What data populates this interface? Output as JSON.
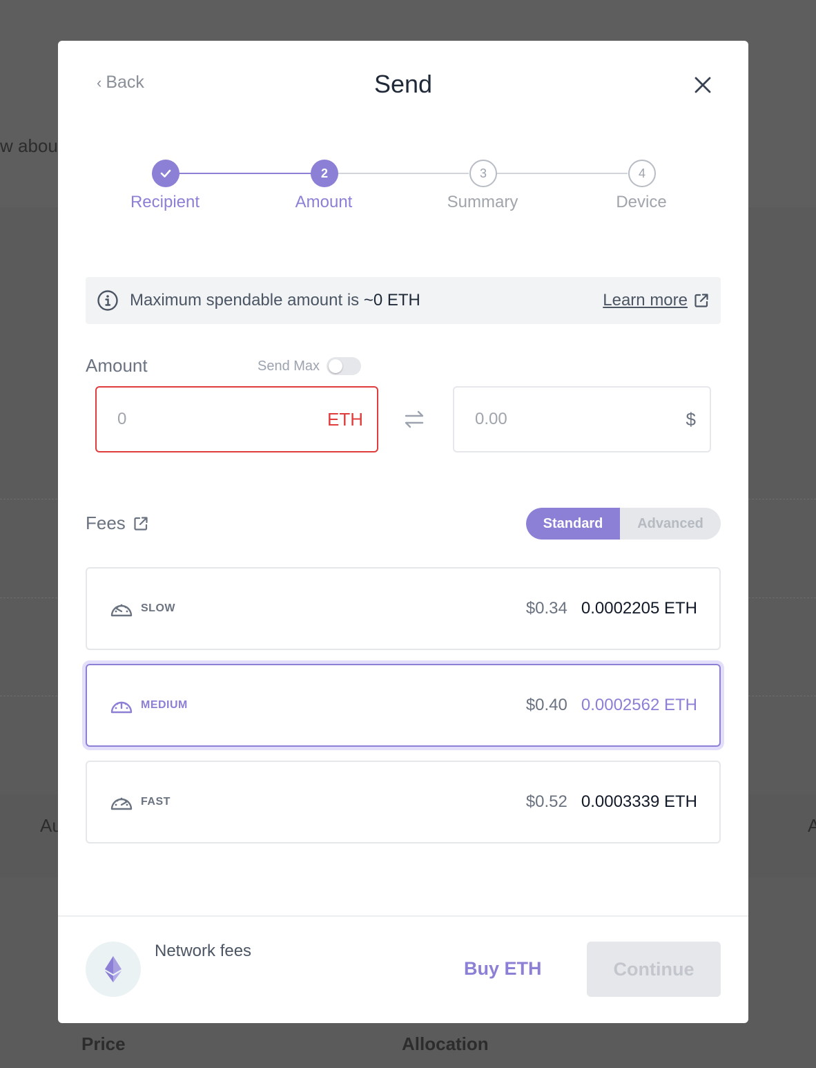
{
  "background": {
    "snippet_top": "w abou",
    "snippet_mid_left": "Au",
    "snippet_mid_right": "A",
    "col_price": "Price",
    "col_allocation": "Allocation"
  },
  "modal": {
    "back_label": "Back",
    "title": "Send",
    "close_icon": "close-icon"
  },
  "stepper": {
    "steps": [
      {
        "label": "Recipient",
        "marker": "",
        "state": "done"
      },
      {
        "label": "Amount",
        "marker": "2",
        "state": "active"
      },
      {
        "label": "Summary",
        "marker": "3",
        "state": "pending"
      },
      {
        "label": "Device",
        "marker": "4",
        "state": "pending"
      }
    ]
  },
  "info": {
    "prefix": "Maximum spendable amount is ",
    "value": "~0 ETH",
    "learn_more": "Learn more"
  },
  "amount": {
    "label": "Amount",
    "send_max_label": "Send Max",
    "send_max_on": false,
    "crypto_placeholder": "0",
    "crypto_unit": "ETH",
    "fiat_placeholder": "0.00",
    "fiat_unit": "$"
  },
  "fees": {
    "label": "Fees",
    "mode_standard": "Standard",
    "mode_advanced": "Advanced",
    "options": [
      {
        "name": "SLOW",
        "usd": "$0.34",
        "eth": "0.0002205 ETH",
        "selected": false
      },
      {
        "name": "MEDIUM",
        "usd": "$0.40",
        "eth": "0.0002562 ETH",
        "selected": true
      },
      {
        "name": "FAST",
        "usd": "$0.52",
        "eth": "0.0003339 ETH",
        "selected": false
      }
    ]
  },
  "footer": {
    "network_fees_label": "Network fees",
    "buy_label": "Buy ETH",
    "continue_label": "Continue"
  },
  "colors": {
    "accent": "#8b7fd6",
    "error": "#e03c3c",
    "overlay": "#5b5b5b"
  }
}
